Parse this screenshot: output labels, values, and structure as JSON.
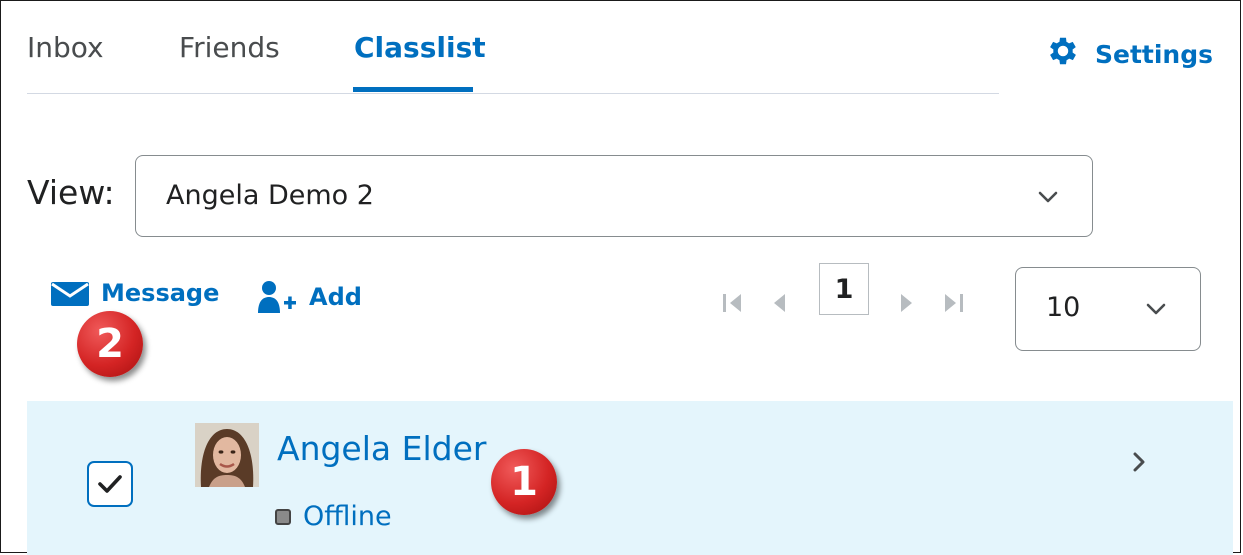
{
  "tabs": [
    {
      "label": "Inbox",
      "active": false
    },
    {
      "label": "Friends",
      "active": false
    },
    {
      "label": "Classlist",
      "active": true
    }
  ],
  "settings": {
    "label": "Settings",
    "icon": "gear-icon"
  },
  "view": {
    "label": "View:",
    "selected": "Angela Demo 2"
  },
  "actions": {
    "message": "Message",
    "add": "Add"
  },
  "pagination": {
    "current_page": "1",
    "per_page": "10"
  },
  "annotations": {
    "badge_1": "1",
    "badge_2": "2"
  },
  "student": {
    "name": "Angela Elder",
    "status": "Offline",
    "checked": true
  },
  "colors": {
    "accent": "#006fbf",
    "row_highlight": "#e4f5fc",
    "badge": "#d42424"
  }
}
